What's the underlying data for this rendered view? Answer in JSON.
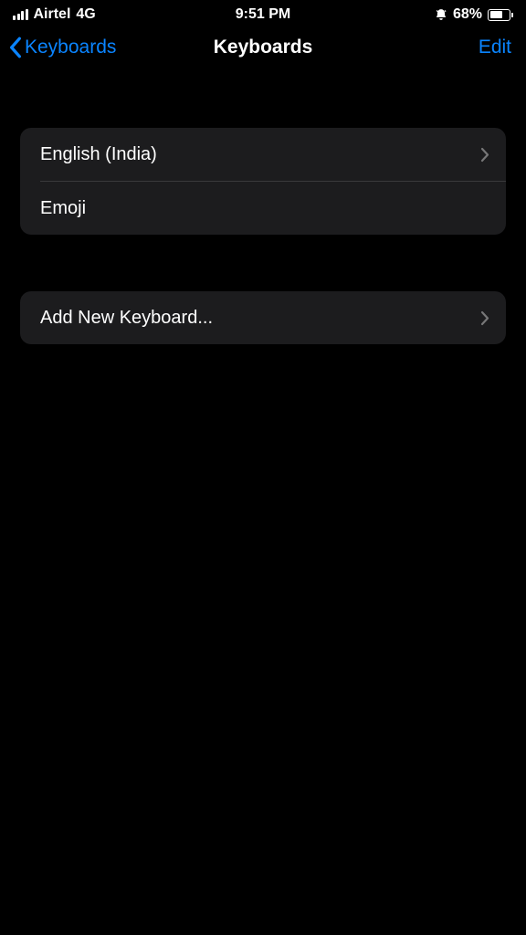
{
  "statusBar": {
    "carrier": "Airtel",
    "network": "4G",
    "time": "9:51 PM",
    "batteryPercent": "68%"
  },
  "nav": {
    "backLabel": "Keyboards",
    "title": "Keyboards",
    "editLabel": "Edit"
  },
  "keyboards": [
    {
      "label": "English (India)",
      "hasChevron": true
    },
    {
      "label": "Emoji",
      "hasChevron": false
    }
  ],
  "addNew": {
    "label": "Add New Keyboard..."
  }
}
